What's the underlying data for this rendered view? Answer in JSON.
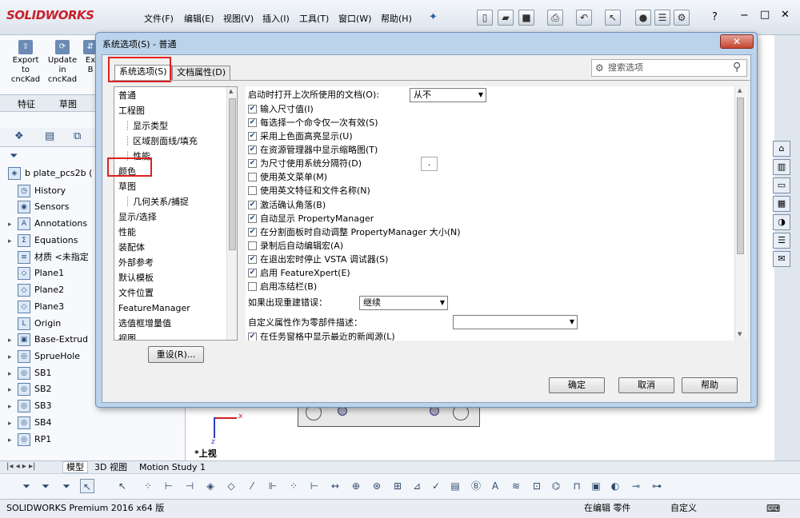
{
  "app": {
    "brand": "SOLIDWORKS"
  },
  "menu": [
    "文件(F)",
    "编辑(E)",
    "视图(V)",
    "插入(I)",
    "工具(T)",
    "窗口(W)",
    "帮助(H)"
  ],
  "cmd_buttons": [
    {
      "label": "Export\nto\ncncKad"
    },
    {
      "label": "Update\nin\ncncKad"
    },
    {
      "label": "Ex\nB"
    }
  ],
  "feature_tabs": [
    "特征",
    "草图"
  ],
  "tree": {
    "part": "b plate_pcs2b  (",
    "items": [
      "History",
      "Sensors",
      "Annotations",
      "Equations",
      "材质 <未指定",
      "Plane1",
      "Plane2",
      "Plane3",
      "Origin",
      "Base-Extrud",
      "SprueHole",
      "SB1",
      "SB2",
      "SB3",
      "SB4",
      "RP1"
    ]
  },
  "bottom_tabs": [
    "模型",
    "3D 视图",
    "Motion Study 1"
  ],
  "view_label": "*上视",
  "status": {
    "left": "SOLIDWORKS Premium 2016 x64 版",
    "editing": "在编辑 零件",
    "custom": "自定义"
  },
  "dialog": {
    "title": "系统选项(S) - 普通",
    "tabs": [
      "系统选项(S)",
      "文档属性(D)"
    ],
    "search_placeholder": "搜索选项",
    "categories": [
      {
        "label": "普通",
        "sub": false
      },
      {
        "label": "工程图",
        "sub": false
      },
      {
        "label": "显示类型",
        "sub": true
      },
      {
        "label": "区域剖面线/填充",
        "sub": true
      },
      {
        "label": "性能",
        "sub": true
      },
      {
        "label": "颜色",
        "sub": false
      },
      {
        "label": "草图",
        "sub": false
      },
      {
        "label": "几何关系/捕捉",
        "sub": true
      },
      {
        "label": "显示/选择",
        "sub": false
      },
      {
        "label": "性能",
        "sub": false
      },
      {
        "label": "装配体",
        "sub": false
      },
      {
        "label": "外部参考",
        "sub": false
      },
      {
        "label": "默认模板",
        "sub": false
      },
      {
        "label": "文件位置",
        "sub": false
      },
      {
        "label": "FeatureManager",
        "sub": false
      },
      {
        "label": "选值框增量值",
        "sub": false
      },
      {
        "label": "视图",
        "sub": false
      }
    ],
    "reset_label": "重设(R)...",
    "open_last_label": "启动时打开上次所使用的文档(O):",
    "open_last_value": "从不",
    "options": [
      {
        "label": "输入尺寸值(I)",
        "checked": true
      },
      {
        "label": "每选择一个命令仅一次有效(S)",
        "checked": true
      },
      {
        "label": "采用上色面高亮显示(U)",
        "checked": true
      },
      {
        "label": "在资源管理器中显示缩略图(T)",
        "checked": true
      },
      {
        "label": "为尺寸使用系统分隔符(D)",
        "checked": true
      },
      {
        "label": "使用英文菜单(M)",
        "checked": false
      },
      {
        "label": "使用英文特征和文件名称(N)",
        "checked": false
      },
      {
        "label": "激活确认角落(B)",
        "checked": true
      },
      {
        "label": "自动显示 PropertyManager",
        "checked": true
      },
      {
        "label": "在分割面板时自动调整 PropertyManager 大小(N)",
        "checked": true
      },
      {
        "label": "录制后自动编辑宏(A)",
        "checked": false
      },
      {
        "label": "在退出宏时停止 VSTA 调试器(S)",
        "checked": true
      },
      {
        "label": "启用 FeatureXpert(E)",
        "checked": true
      },
      {
        "label": "启用冻结栏(B)",
        "checked": false
      }
    ],
    "separator_value": ".",
    "rebuild_error_label": "如果出现重建错误：",
    "rebuild_error_value": "继续",
    "custom_prop_label": "自定义属性作为零部件描述：",
    "custom_prop_value": "",
    "last_option_label": "在任务窗格中显示最近的新闻源(L)",
    "buttons": {
      "ok": "确定",
      "cancel": "取消",
      "help": "帮助"
    }
  },
  "colors": {
    "highlight": "#e02020",
    "brand": "#c8202b"
  }
}
